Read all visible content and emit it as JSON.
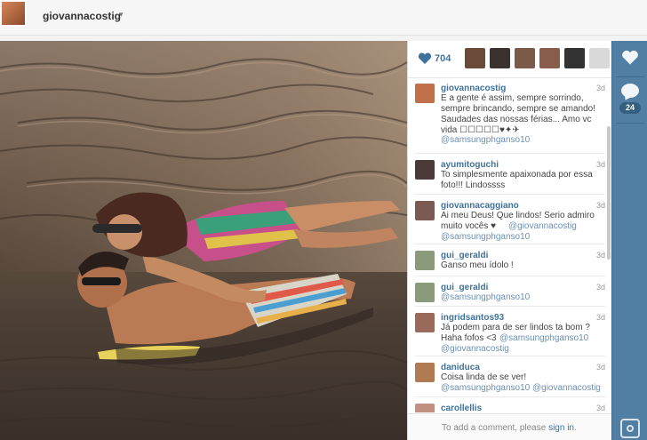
{
  "header": {
    "username": "giovannacostig",
    "caret": "▾"
  },
  "likes": {
    "count": "704"
  },
  "likers": [
    {
      "color": "#6b4a3a"
    },
    {
      "color": "#3b3230"
    },
    {
      "color": "#7a5a48"
    },
    {
      "color": "#8a5c4a"
    },
    {
      "color": "#333333"
    },
    {
      "color": "#d9d9d9"
    }
  ],
  "comments": [
    {
      "user": "giovannacostig",
      "time": "3d",
      "text": "E a gente é assim, sempre sorrindo, sempre brincando, sempre se amando! Saudades das nossas férias... Amo vc vida ☐☐☐☐☐♥✦✈",
      "mentions": [
        "@samsungphganso10"
      ],
      "avatar": "#c0704a"
    },
    {
      "user": "ayumitoguchi",
      "time": "3d",
      "text": "To simplesmente apaixonada por essa foto!!! Lindossss",
      "mentions": [],
      "avatar": "#4a3a3a"
    },
    {
      "user": "giovannacaggiano",
      "time": "3d",
      "text": "Ai meu Deus! Que lindos! Serio admiro muito vocês ♥",
      "mentions": [
        "@giovannacostig",
        "@samsungphganso10"
      ],
      "avatar": "#7a5a52"
    },
    {
      "user": "gui_geraldi",
      "time": "3d",
      "text": "Ganso meu ídolo !",
      "mentions": [],
      "avatar": "#8a9a7a"
    },
    {
      "user": "gui_geraldi",
      "time": "3d",
      "text": "",
      "mentions": [
        "@samsungphganso10"
      ],
      "avatar": "#8a9a7a"
    },
    {
      "user": "ingridsantos93",
      "time": "3d",
      "text": "Já podem para de ser lindos ta bom ? Haha fofos <3",
      "mentions": [
        "@samsungphganso10",
        "@giovannacostig"
      ],
      "avatar": "#9a6a5a"
    },
    {
      "user": "daniduca",
      "time": "3d",
      "text": "Coisa linda de se ver!",
      "mentions": [
        "@samsungphganso10 @giovannacostig"
      ],
      "avatar": "#b07a52"
    },
    {
      "user": "carollellis",
      "time": "3d",
      "text": "",
      "mentions": [],
      "avatar": "#c09080"
    }
  ],
  "add_comment": {
    "prefix": "To add a comment, please",
    "link": "sign in",
    "suffix": "."
  },
  "actions": {
    "comment_count": "24"
  },
  "colors": {
    "accent": "#3f729b",
    "actionbar": "#517fa4"
  }
}
